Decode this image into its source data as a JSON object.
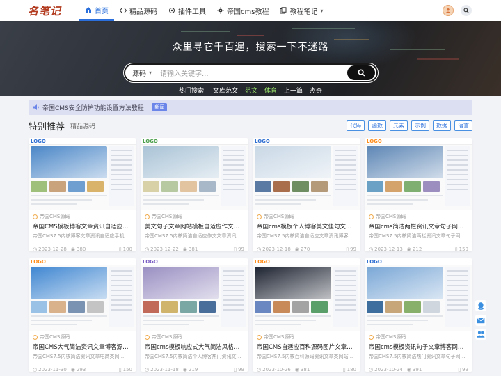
{
  "header": {
    "logo_text": "名笔记",
    "nav": [
      {
        "label": "首页",
        "icon": "home-icon",
        "active": true
      },
      {
        "label": "精品源码",
        "icon": "code-icon"
      },
      {
        "label": "插件工具",
        "icon": "puzzle-icon"
      },
      {
        "label": "帝国cms教程",
        "icon": "gear-icon"
      },
      {
        "label": "教程笔记",
        "icon": "copy-icon",
        "dropdown": true
      }
    ]
  },
  "hero": {
    "title": "众里寻它千百遍，搜索一下不迷路",
    "search": {
      "select_value": "源码",
      "placeholder": "请输入关键字..."
    },
    "hot_label": "热门搜索:",
    "hot_links": [
      "文库范文",
      "范文",
      "体育",
      "上一篇",
      "杰奇"
    ]
  },
  "notice": {
    "text": "帝国CMS安全防护功能设置方法教程!",
    "tag": "新闻"
  },
  "section": {
    "title": "特别推荐",
    "subtitle": "精品源码",
    "tags": [
      "代码",
      "函数",
      "元素",
      "示例",
      "数据",
      "语言"
    ]
  },
  "cards": [
    {
      "category": "帝国CMS源码",
      "title": "帝国CMS模板博客文章资讯自适应手机H...",
      "desc": "帝国CMS7.5内核博客文章资讯自适应手机HT...",
      "date": "2023-12-28",
      "views": "380",
      "likes": "100"
    },
    {
      "category": "帝国CMS源码",
      "title": "美文句子文章网站模板自适应作文百科资...",
      "desc": "帝国CMS7.5内核简洁自适应作文文章资讯网...",
      "date": "2023-12-22",
      "views": "381",
      "likes": "99"
    },
    {
      "category": "帝国CMS源码",
      "title": "帝国cms模板个人博客美文佳句文章资讯...",
      "desc": "帝国CMS7.5内核简洁自适应文章资讯博客新...",
      "date": "2023-12-18",
      "views": "270",
      "likes": "99"
    },
    {
      "category": "帝国CMS源码",
      "title": "帝国cms简洁两栏资讯文章句子网美文源...",
      "desc": "帝国CMS7.5内核简洁两栏资讯文章句子网美...",
      "date": "2023-12-13",
      "views": "212",
      "likes": "150"
    },
    {
      "category": "帝国CMS源码",
      "title": "帝国CMS大气简洁资讯文章博客源码电商...",
      "desc": "帝国CMS7.5内核简洁资讯文章电商类网...",
      "date": "2023-11-30",
      "views": "293",
      "likes": "150"
    },
    {
      "category": "帝国CMS源码",
      "title": "帝国cms模板响应式大气简洁风格资讯文...",
      "desc": "帝国CMS7.5内核简洁个人博客热门资讯文章...",
      "date": "2023-11-18",
      "views": "219",
      "likes": "99"
    },
    {
      "category": "帝国CMS源码",
      "title": "帝国CMS自适应百科源码图片文章资讯通...",
      "desc": "帝国CMS7.5内核百科源码资讯文章类网站...",
      "date": "2023-10-26",
      "views": "381",
      "likes": "180"
    },
    {
      "category": "帝国CMS源码",
      "title": "帝国cms模板资讯句子文章博客网站自适...",
      "desc": "帝国CMS7.5内核简洁热门资讯文章句子网美...",
      "date": "2023-10-24",
      "views": "391",
      "likes": "99"
    }
  ],
  "thumb_colors": [
    {
      "hero": "#4a86c7",
      "row": [
        "#9ec07a",
        "#c9a37c",
        "#6f9ed1",
        "#d9b36a"
      ],
      "logo_color": "#2f6fd1"
    },
    {
      "hero": "#a9c3d6",
      "row": [
        "#d8d1a7",
        "#b6c9a0",
        "#e2c4a0",
        "#a8b8c8"
      ],
      "logo_color": "#4a9e4a"
    },
    {
      "hero": "#c9d8e6",
      "row": [
        "#5a7aa3",
        "#a96e4b",
        "#6f8f62",
        "#b59a7a"
      ],
      "logo_color": "#2f6fd1"
    },
    {
      "hero": "#5d86b5",
      "row": [
        "#6aa1c4",
        "#d3a36b",
        "#7fb072",
        "#9c8fc0"
      ],
      "logo_color": "#ff8c1a"
    },
    {
      "hero": "#3f86d1",
      "row": [
        "#9ac1e6",
        "#d9b18a",
        "#7b93b3",
        "#c4c4c4"
      ],
      "logo_color": "#ff8c1a"
    },
    {
      "hero": "#9a8fc2",
      "row": [
        "#c26a5a",
        "#d1b46b",
        "#7aa6a3",
        "#4a6e9a"
      ],
      "logo_color": "#7a5ec2"
    },
    {
      "hero": "#1c2230",
      "row": [
        "#6a87c2",
        "#c98a5a",
        "#a3a3a3",
        "#5a9e6a"
      ],
      "logo_color": "#ff8c1a"
    },
    {
      "hero": "#7aa7d6",
      "row": [
        "#3e6e9e",
        "#c7a77a",
        "#89b06a",
        "#d0d6de"
      ],
      "logo_color": "#2f6fd1"
    }
  ]
}
